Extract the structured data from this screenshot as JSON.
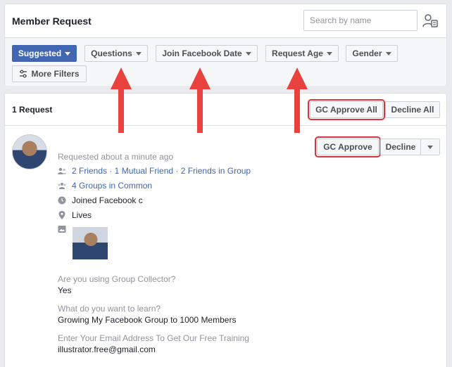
{
  "header": {
    "title": "Member Request",
    "search_placeholder": "Search by name",
    "person_icon": "person-list-icon"
  },
  "filters": {
    "suggested": "Suggested",
    "questions": "Questions",
    "join_date": "Join Facebook Date",
    "request_age": "Request Age",
    "gender": "Gender",
    "more_filters": "More Filters"
  },
  "requests": {
    "count_label": "1 Request",
    "approve_all": "GC Approve All",
    "decline_all": "Decline All"
  },
  "member": {
    "requested": "Requested about a minute ago",
    "friends": "2 Friends · 1 Mutual Friend · 2 Friends in Group",
    "groups": "4 Groups in Common",
    "joined": "Joined Facebook c",
    "lives": "Lives",
    "approve": "GC Approve",
    "decline": "Decline"
  },
  "answers": [
    {
      "question": "Are you using Group Collector?",
      "answer": "Yes"
    },
    {
      "question": "What do you want to learn?",
      "answer": "Growing My Facebook Group to 1000 Members"
    },
    {
      "question": "Enter Your Email Address To Get Our Free Training",
      "answer": "illustrator.free@gmail.com"
    }
  ],
  "colors": {
    "accent": "#4267b2",
    "highlight": "#d8343d",
    "arrow": "#e8413e"
  }
}
